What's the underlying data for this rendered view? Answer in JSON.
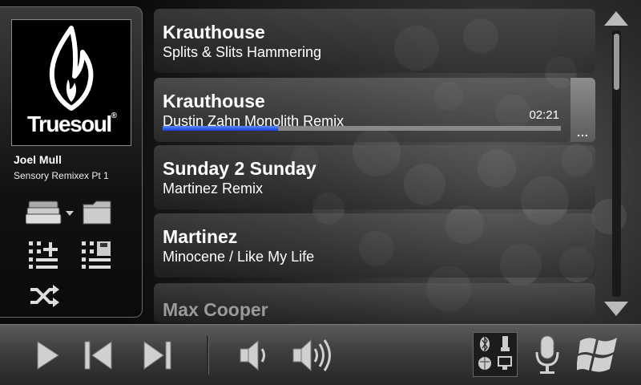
{
  "now_playing": {
    "label_logo": "Truesoul",
    "artist": "Joel Mull",
    "album": "Sensory Remixex Pt 1"
  },
  "playlist": [
    {
      "title": "Krauthouse",
      "subtitle": "Splits & Slits Hammering"
    },
    {
      "title": "Krauthouse",
      "subtitle": "Dustin Zahn Monolith Remix",
      "time": "02:21",
      "progress": 0.29,
      "selected": true
    },
    {
      "title": "Sunday 2 Sunday",
      "subtitle": "Martinez Remix"
    },
    {
      "title": "Martinez",
      "subtitle": "Minocene / Like My Life"
    },
    {
      "title": "Max Cooper",
      "subtitle": ""
    }
  ],
  "more_label": "...",
  "colors": {
    "progress": "#2244dd",
    "background": "#0a0a0a"
  },
  "icons": {
    "source": "layers-icon",
    "folder": "folder-icon",
    "add_to_list": "list-add-icon",
    "save_list": "list-save-icon",
    "shuffle": "shuffle-icon",
    "play": "play-icon",
    "previous": "previous-icon",
    "next": "next-icon",
    "volume_down": "volume-down-icon",
    "volume_up": "volume-up-icon",
    "connectivity": "connectivity-icon",
    "microphone": "microphone-icon",
    "windows": "windows-logo-icon"
  }
}
